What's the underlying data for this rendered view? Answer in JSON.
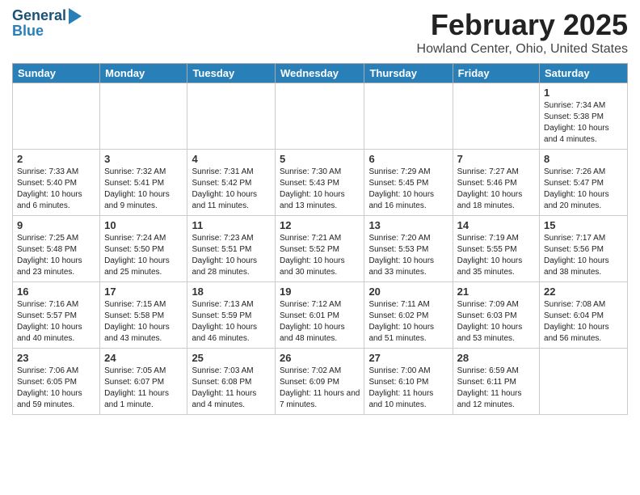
{
  "header": {
    "logo_line1": "General",
    "logo_line2": "Blue",
    "month_title": "February 2025",
    "location": "Howland Center, Ohio, United States"
  },
  "days_of_week": [
    "Sunday",
    "Monday",
    "Tuesday",
    "Wednesday",
    "Thursday",
    "Friday",
    "Saturday"
  ],
  "weeks": [
    [
      {
        "day": "",
        "info": ""
      },
      {
        "day": "",
        "info": ""
      },
      {
        "day": "",
        "info": ""
      },
      {
        "day": "",
        "info": ""
      },
      {
        "day": "",
        "info": ""
      },
      {
        "day": "",
        "info": ""
      },
      {
        "day": "1",
        "info": "Sunrise: 7:34 AM\nSunset: 5:38 PM\nDaylight: 10 hours and 4 minutes."
      }
    ],
    [
      {
        "day": "2",
        "info": "Sunrise: 7:33 AM\nSunset: 5:40 PM\nDaylight: 10 hours and 6 minutes."
      },
      {
        "day": "3",
        "info": "Sunrise: 7:32 AM\nSunset: 5:41 PM\nDaylight: 10 hours and 9 minutes."
      },
      {
        "day": "4",
        "info": "Sunrise: 7:31 AM\nSunset: 5:42 PM\nDaylight: 10 hours and 11 minutes."
      },
      {
        "day": "5",
        "info": "Sunrise: 7:30 AM\nSunset: 5:43 PM\nDaylight: 10 hours and 13 minutes."
      },
      {
        "day": "6",
        "info": "Sunrise: 7:29 AM\nSunset: 5:45 PM\nDaylight: 10 hours and 16 minutes."
      },
      {
        "day": "7",
        "info": "Sunrise: 7:27 AM\nSunset: 5:46 PM\nDaylight: 10 hours and 18 minutes."
      },
      {
        "day": "8",
        "info": "Sunrise: 7:26 AM\nSunset: 5:47 PM\nDaylight: 10 hours and 20 minutes."
      }
    ],
    [
      {
        "day": "9",
        "info": "Sunrise: 7:25 AM\nSunset: 5:48 PM\nDaylight: 10 hours and 23 minutes."
      },
      {
        "day": "10",
        "info": "Sunrise: 7:24 AM\nSunset: 5:50 PM\nDaylight: 10 hours and 25 minutes."
      },
      {
        "day": "11",
        "info": "Sunrise: 7:23 AM\nSunset: 5:51 PM\nDaylight: 10 hours and 28 minutes."
      },
      {
        "day": "12",
        "info": "Sunrise: 7:21 AM\nSunset: 5:52 PM\nDaylight: 10 hours and 30 minutes."
      },
      {
        "day": "13",
        "info": "Sunrise: 7:20 AM\nSunset: 5:53 PM\nDaylight: 10 hours and 33 minutes."
      },
      {
        "day": "14",
        "info": "Sunrise: 7:19 AM\nSunset: 5:55 PM\nDaylight: 10 hours and 35 minutes."
      },
      {
        "day": "15",
        "info": "Sunrise: 7:17 AM\nSunset: 5:56 PM\nDaylight: 10 hours and 38 minutes."
      }
    ],
    [
      {
        "day": "16",
        "info": "Sunrise: 7:16 AM\nSunset: 5:57 PM\nDaylight: 10 hours and 40 minutes."
      },
      {
        "day": "17",
        "info": "Sunrise: 7:15 AM\nSunset: 5:58 PM\nDaylight: 10 hours and 43 minutes."
      },
      {
        "day": "18",
        "info": "Sunrise: 7:13 AM\nSunset: 5:59 PM\nDaylight: 10 hours and 46 minutes."
      },
      {
        "day": "19",
        "info": "Sunrise: 7:12 AM\nSunset: 6:01 PM\nDaylight: 10 hours and 48 minutes."
      },
      {
        "day": "20",
        "info": "Sunrise: 7:11 AM\nSunset: 6:02 PM\nDaylight: 10 hours and 51 minutes."
      },
      {
        "day": "21",
        "info": "Sunrise: 7:09 AM\nSunset: 6:03 PM\nDaylight: 10 hours and 53 minutes."
      },
      {
        "day": "22",
        "info": "Sunrise: 7:08 AM\nSunset: 6:04 PM\nDaylight: 10 hours and 56 minutes."
      }
    ],
    [
      {
        "day": "23",
        "info": "Sunrise: 7:06 AM\nSunset: 6:05 PM\nDaylight: 10 hours and 59 minutes."
      },
      {
        "day": "24",
        "info": "Sunrise: 7:05 AM\nSunset: 6:07 PM\nDaylight: 11 hours and 1 minute."
      },
      {
        "day": "25",
        "info": "Sunrise: 7:03 AM\nSunset: 6:08 PM\nDaylight: 11 hours and 4 minutes."
      },
      {
        "day": "26",
        "info": "Sunrise: 7:02 AM\nSunset: 6:09 PM\nDaylight: 11 hours and 7 minutes."
      },
      {
        "day": "27",
        "info": "Sunrise: 7:00 AM\nSunset: 6:10 PM\nDaylight: 11 hours and 10 minutes."
      },
      {
        "day": "28",
        "info": "Sunrise: 6:59 AM\nSunset: 6:11 PM\nDaylight: 11 hours and 12 minutes."
      },
      {
        "day": "",
        "info": ""
      }
    ]
  ]
}
